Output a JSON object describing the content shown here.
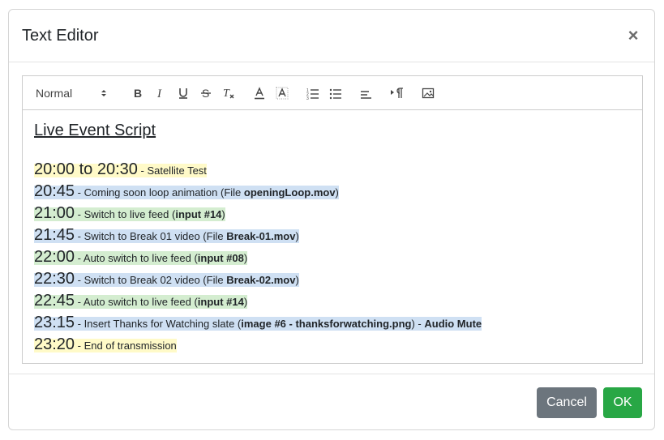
{
  "modal": {
    "title": "Text Editor",
    "close_icon": "×"
  },
  "toolbar": {
    "format_select": "Normal",
    "buttons": [
      {
        "name": "bold-button",
        "glyph": "B"
      },
      {
        "name": "italic-button",
        "glyph": "I"
      },
      {
        "name": "underline-button",
        "glyph": "U"
      },
      {
        "name": "strike-button",
        "glyph": "S"
      },
      {
        "name": "clear-format-button",
        "glyph": "Tx"
      }
    ]
  },
  "script": {
    "title": "Live Event Script",
    "entries": [
      {
        "time": "20:00 to 20:30",
        "parts": [
          {
            "t": " - Satellite Test",
            "b": false
          }
        ],
        "color": "yellow"
      },
      {
        "time": "20:45",
        "parts": [
          {
            "t": " - Coming soon loop animation (File ",
            "b": false
          },
          {
            "t": "openingLoop.mov",
            "b": true
          },
          {
            "t": ")",
            "b": false
          }
        ],
        "color": "blue"
      },
      {
        "time": "21:00",
        "parts": [
          {
            "t": " - Switch to live feed (",
            "b": false
          },
          {
            "t": "input #14",
            "b": true
          },
          {
            "t": ")",
            "b": false
          }
        ],
        "color": "green"
      },
      {
        "time": "21:45",
        "parts": [
          {
            "t": " - Switch to Break 01 video (File ",
            "b": false
          },
          {
            "t": "Break-01.mov",
            "b": true
          },
          {
            "t": ")",
            "b": false
          }
        ],
        "color": "blue"
      },
      {
        "time": "22:00",
        "parts": [
          {
            "t": " - Auto switch to live feed (",
            "b": false
          },
          {
            "t": "input #08",
            "b": true
          },
          {
            "t": ")",
            "b": false
          }
        ],
        "color": "green"
      },
      {
        "time": "22:30",
        "parts": [
          {
            "t": " - Switch to Break 02 video (File ",
            "b": false
          },
          {
            "t": "Break-02.mov",
            "b": true
          },
          {
            "t": ")",
            "b": false
          }
        ],
        "color": "blue"
      },
      {
        "time": "22:45",
        "parts": [
          {
            "t": " - Auto switch to live feed (",
            "b": false
          },
          {
            "t": "input #14",
            "b": true
          },
          {
            "t": ")",
            "b": false
          }
        ],
        "color": "green"
      },
      {
        "time": "23:15",
        "parts": [
          {
            "t": " - Insert Thanks for Watching slate (",
            "b": false
          },
          {
            "t": "image #6 - thanksforwatching.png",
            "b": true
          },
          {
            "t": ") - ",
            "b": false
          },
          {
            "t": "Audio Mute",
            "b": true
          }
        ],
        "color": "blue"
      },
      {
        "time": "23:20",
        "parts": [
          {
            "t": " - End of transmission",
            "b": false
          }
        ],
        "color": "yellow"
      }
    ]
  },
  "footer": {
    "cancel_label": "Cancel",
    "ok_label": "OK"
  },
  "colors": {
    "yellow": "#fffac8",
    "blue": "#cfe0f3",
    "green": "#d4edd0",
    "ok": "#28a745",
    "cancel": "#6c757d"
  }
}
